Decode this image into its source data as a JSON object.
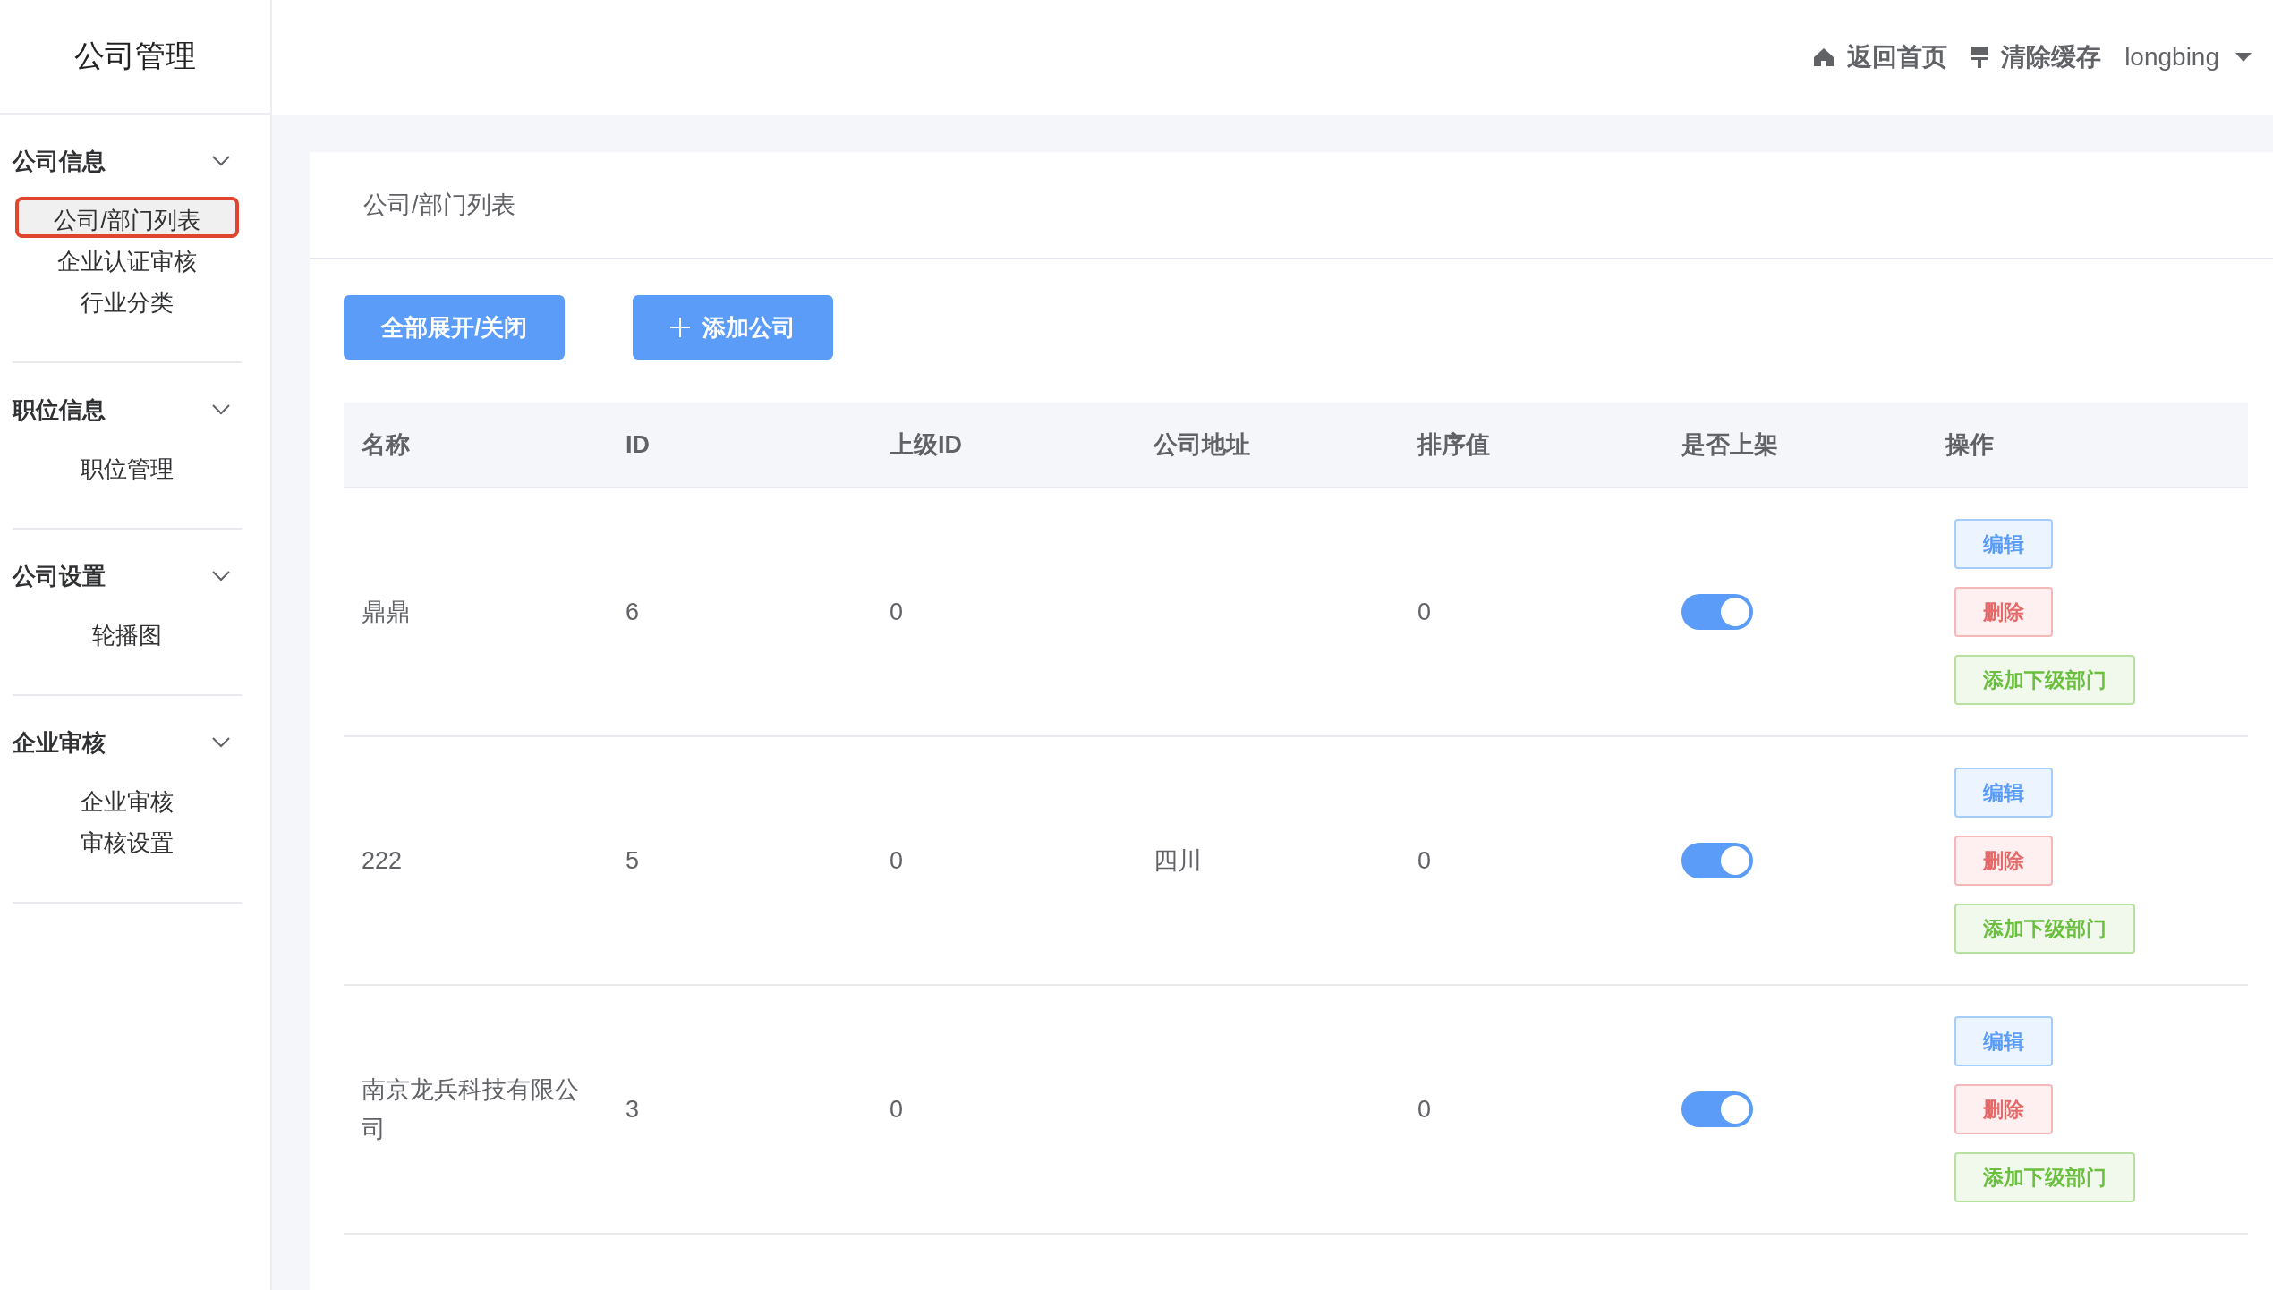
{
  "sidebar": {
    "title": "公司管理",
    "groups": [
      {
        "title": "公司信息",
        "expanded": true,
        "items": [
          {
            "label": "公司/部门列表",
            "selected": true
          },
          {
            "label": "企业认证审核",
            "selected": false
          },
          {
            "label": "行业分类",
            "selected": false
          }
        ]
      },
      {
        "title": "职位信息",
        "expanded": true,
        "items": [
          {
            "label": "职位管理",
            "selected": false
          }
        ]
      },
      {
        "title": "公司设置",
        "expanded": true,
        "items": [
          {
            "label": "轮播图",
            "selected": false
          }
        ]
      },
      {
        "title": "企业审核",
        "expanded": true,
        "items": [
          {
            "label": "企业审核",
            "selected": false
          },
          {
            "label": "审核设置",
            "selected": false
          }
        ]
      }
    ]
  },
  "header": {
    "home": "返回首页",
    "clear_cache": "清除缓存",
    "user": "longbing"
  },
  "page_title": "公司/部门列表",
  "toolbar": {
    "toggle_all": "全部展开/关闭",
    "add_company": "添加公司"
  },
  "table": {
    "columns": [
      "名称",
      "ID",
      "上级ID",
      "公司地址",
      "排序值",
      "是否上架",
      "操作"
    ],
    "rows": [
      {
        "name": "鼎鼎",
        "id": "6",
        "parent_id": "0",
        "address": "",
        "sort": "0",
        "on": true,
        "actions": [
          "编辑",
          "删除",
          "添加下级部门"
        ]
      },
      {
        "name": "222",
        "id": "5",
        "parent_id": "0",
        "address": "四川",
        "sort": "0",
        "on": true,
        "actions": [
          "编辑",
          "删除",
          "添加下级部门"
        ]
      },
      {
        "name": "南京龙兵科技有限公司",
        "id": "3",
        "parent_id": "0",
        "address": "",
        "sort": "0",
        "on": true,
        "actions": [
          "编辑",
          "删除",
          "添加下级部门"
        ]
      }
    ]
  }
}
